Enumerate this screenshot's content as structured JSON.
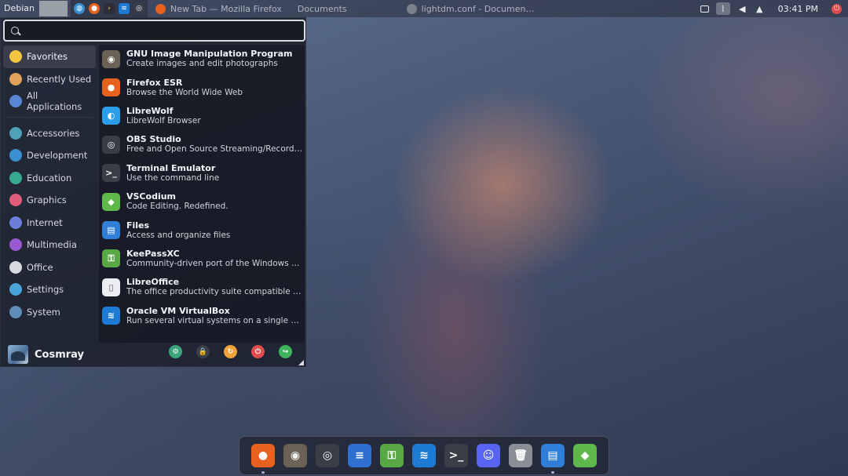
{
  "top_panel": {
    "menu_label": "Debian",
    "tasks": [
      {
        "label": "New Tab — Mozilla Firefox",
        "icon": "firefox-icon"
      },
      {
        "label": "Documents",
        "icon": "folder-icon"
      },
      {
        "label": "lightdm.conf - Documen…",
        "icon": "text-editor-icon"
      }
    ],
    "clock": "03:41 PM"
  },
  "search": {
    "value": "",
    "placeholder": ""
  },
  "sidebar": {
    "items": [
      {
        "label": "Favorites",
        "icon": "star-icon",
        "color": "#f4c542"
      },
      {
        "label": "Recently Used",
        "icon": "clock-icon",
        "color": "#e0a25a"
      },
      {
        "label": "All Applications",
        "icon": "apps-grid-icon",
        "color": "#5a86d6"
      },
      {
        "label": "Accessories",
        "icon": "accessories-icon",
        "color": "#4fa1b8"
      },
      {
        "label": "Development",
        "icon": "development-icon",
        "color": "#3a8fd1"
      },
      {
        "label": "Education",
        "icon": "education-icon",
        "color": "#38a88f"
      },
      {
        "label": "Graphics",
        "icon": "graphics-icon",
        "color": "#e05d7a"
      },
      {
        "label": "Internet",
        "icon": "internet-icon",
        "color": "#6a7fd8"
      },
      {
        "label": "Multimedia",
        "icon": "multimedia-icon",
        "color": "#9a5bd1"
      },
      {
        "label": "Office",
        "icon": "office-icon",
        "color": "#d9dbe0"
      },
      {
        "label": "Settings",
        "icon": "settings-icon",
        "color": "#4aa3d9"
      },
      {
        "label": "System",
        "icon": "system-icon",
        "color": "#5f8fb8"
      }
    ]
  },
  "apps": [
    {
      "name": "GNU Image Manipulation Program",
      "desc": "Create images and edit photographs",
      "icon": "gimp-icon",
      "color": "#6b6155",
      "glyph": "◉"
    },
    {
      "name": "Firefox ESR",
      "desc": "Browse the World Wide Web",
      "icon": "firefox-icon",
      "color": "#e8621f",
      "glyph": "●"
    },
    {
      "name": "LibreWolf",
      "desc": "LibreWolf Browser",
      "icon": "librewolf-icon",
      "color": "#2a9ee8",
      "glyph": "◐"
    },
    {
      "name": "OBS Studio",
      "desc": "Free and Open Source Streaming/Recordi…",
      "icon": "obs-icon",
      "color": "#3a3d46",
      "glyph": "◎"
    },
    {
      "name": "Terminal Emulator",
      "desc": "Use the command line",
      "icon": "terminal-icon",
      "color": "#3b3e46",
      "glyph": ">_"
    },
    {
      "name": "VSCodium",
      "desc": "Code Editing. Redefined.",
      "icon": "vscodium-icon",
      "color": "#5fb84a",
      "glyph": "◆"
    },
    {
      "name": "Files",
      "desc": "Access and organize files",
      "icon": "files-icon",
      "color": "#2f7fd9",
      "glyph": "▤"
    },
    {
      "name": "KeePassXC",
      "desc": "Community-driven port of the Windows …",
      "icon": "keepassxc-icon",
      "color": "#5aa845",
      "glyph": "⚿"
    },
    {
      "name": "LibreOffice",
      "desc": "The office productivity suite compatible t…",
      "icon": "libreoffice-icon",
      "color": "#eceef1",
      "glyph": "▯"
    },
    {
      "name": "Oracle VM VirtualBox",
      "desc": "Run several virtual systems on a single …",
      "icon": "virtualbox-icon",
      "color": "#1e7bd4",
      "glyph": "≋"
    }
  ],
  "user": {
    "name": "Cosmray"
  },
  "actions": [
    {
      "name": "settings-manager-icon",
      "color": "#3aa57a",
      "glyph": "⚙"
    },
    {
      "name": "lock-icon",
      "color": "#3b3f4a",
      "glyph": "🔒"
    },
    {
      "name": "switch-user-icon",
      "color": "#f0a23a",
      "glyph": "↻"
    },
    {
      "name": "power-icon",
      "color": "#e04b4b",
      "glyph": "⏻"
    },
    {
      "name": "logout-icon",
      "color": "#3db35a",
      "glyph": "↪"
    }
  ],
  "dock": [
    {
      "name": "firefox-icon",
      "color": "#e8621f",
      "glyph": "●",
      "running": true
    },
    {
      "name": "gimp-icon",
      "color": "#6b6155",
      "glyph": "◉",
      "running": false
    },
    {
      "name": "obs-icon",
      "color": "#3a3d46",
      "glyph": "◎",
      "running": false
    },
    {
      "name": "text-editor-icon",
      "color": "#2f6fd0",
      "glyph": "≡",
      "running": false
    },
    {
      "name": "keepassxc-icon",
      "color": "#5aa845",
      "glyph": "⚿",
      "running": false
    },
    {
      "name": "system-monitor-icon",
      "color": "#1e7bd4",
      "glyph": "≋",
      "running": false
    },
    {
      "name": "terminal-icon",
      "color": "#3b3e46",
      "glyph": ">_",
      "running": false
    },
    {
      "name": "discord-icon",
      "color": "#5865f2",
      "glyph": "☺",
      "running": false
    },
    {
      "name": "trash-icon",
      "color": "#8a8e96",
      "glyph": "🗑",
      "running": false
    },
    {
      "name": "files-icon",
      "color": "#2f7fd9",
      "glyph": "▤",
      "running": true
    },
    {
      "name": "vscodium-icon",
      "color": "#5fb84a",
      "glyph": "◆",
      "running": false
    }
  ]
}
